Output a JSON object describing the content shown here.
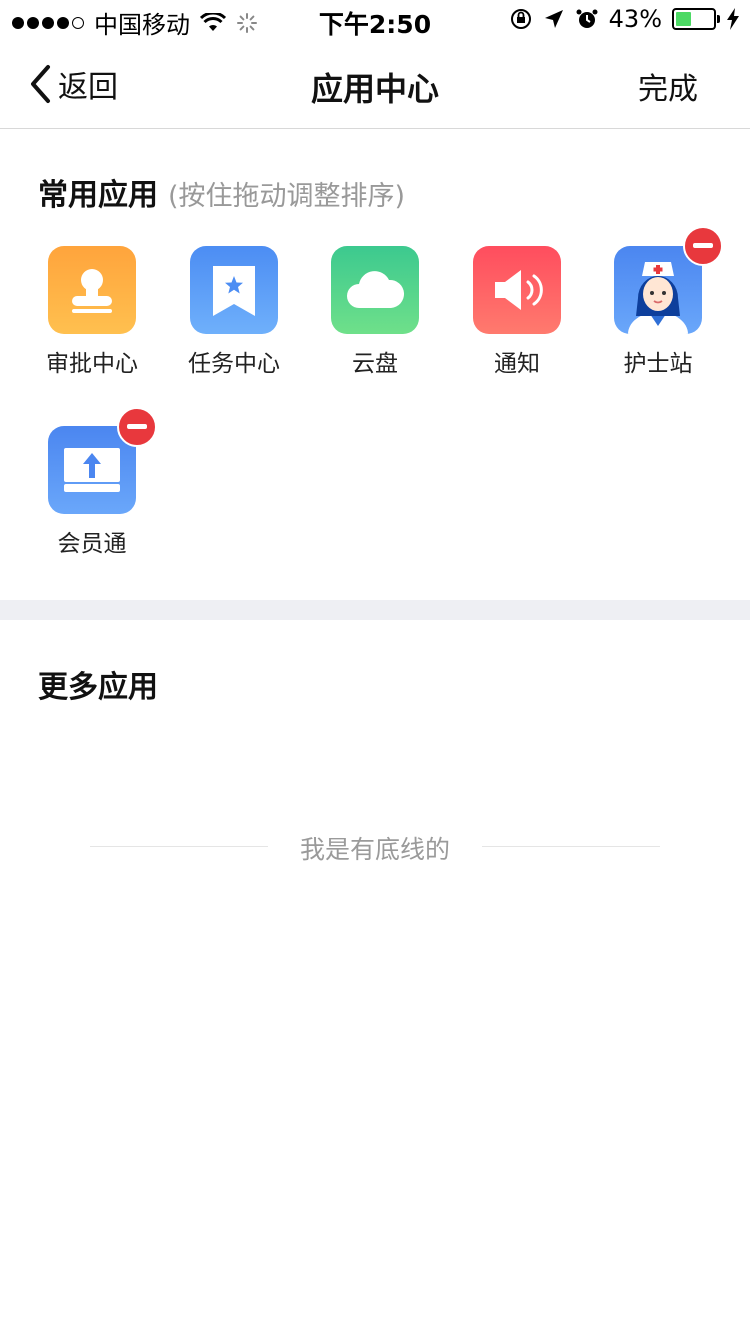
{
  "status_bar": {
    "carrier": "中国移动",
    "time": "下午2:50",
    "battery_percent": "43%",
    "battery_level": 0.43
  },
  "nav": {
    "back_label": "返回",
    "title": "应用中心",
    "done_label": "完成"
  },
  "frequent": {
    "title": "常用应用",
    "hint": "(按住拖动调整排序)",
    "apps": [
      {
        "label": "审批中心",
        "icon": "stamp-icon",
        "removable": false
      },
      {
        "label": "任务中心",
        "icon": "bookmark-star-icon",
        "removable": false
      },
      {
        "label": "云盘",
        "icon": "cloud-icon",
        "removable": false
      },
      {
        "label": "通知",
        "icon": "speaker-icon",
        "removable": false
      },
      {
        "label": "护士站",
        "icon": "nurse-icon",
        "removable": true
      },
      {
        "label": "会员通",
        "icon": "upload-icon",
        "removable": true
      }
    ]
  },
  "more": {
    "title": "更多应用"
  },
  "footer": {
    "text": "我是有底线的"
  }
}
